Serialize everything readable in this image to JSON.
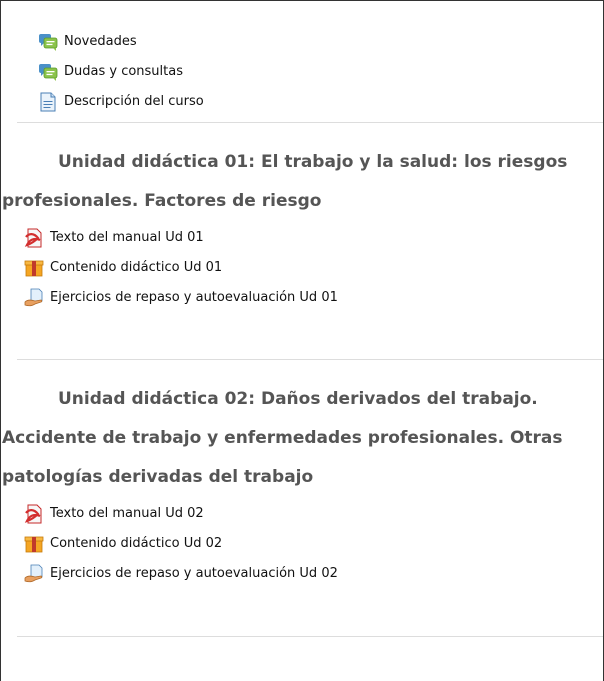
{
  "general": {
    "items": [
      {
        "label": "Novedades",
        "icon": "forum-icon"
      },
      {
        "label": "Dudas y consultas",
        "icon": "forum-icon"
      },
      {
        "label": "Descripción del curso",
        "icon": "page-icon"
      }
    ]
  },
  "units": [
    {
      "title_first": "Unidad didáctica 01: El trabajo y la salud: los riesgos",
      "title_rest": [
        "profesionales. Factores de riesgo"
      ],
      "items": [
        {
          "label": "Texto del manual Ud 01",
          "icon": "pdf-icon"
        },
        {
          "label": "Contenido didáctico Ud 01",
          "icon": "package-icon"
        },
        {
          "label": "Ejercicios de repaso y autoevaluación Ud 01",
          "icon": "assignment-icon"
        }
      ]
    },
    {
      "title_first": "Unidad didáctica 02: Daños derivados del trabajo.",
      "title_rest": [
        "Accidente de trabajo y enfermedades profesionales. Otras",
        "patologías derivadas del trabajo"
      ],
      "items": [
        {
          "label": "Texto del manual Ud 02",
          "icon": "pdf-icon"
        },
        {
          "label": "Contenido didáctico Ud 02",
          "icon": "package-icon"
        },
        {
          "label": "Ejercicios de repaso y autoevaluación Ud 02",
          "icon": "assignment-icon"
        }
      ]
    }
  ]
}
